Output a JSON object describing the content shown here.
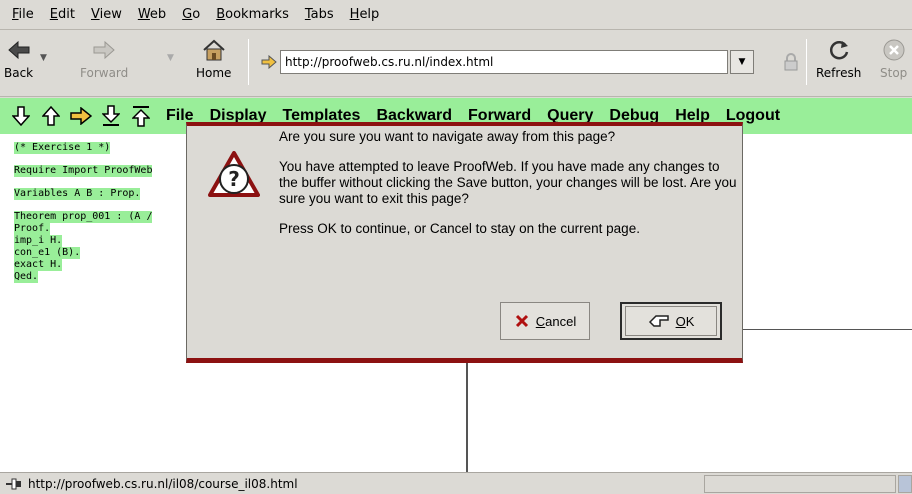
{
  "menu": [
    "File",
    "Edit",
    "View",
    "Web",
    "Go",
    "Bookmarks",
    "Tabs",
    "Help"
  ],
  "nav": {
    "back": "Back",
    "forward": "Forward",
    "home": "Home",
    "url": "http://proofweb.cs.ru.nl/index.html",
    "refresh": "Refresh",
    "stop": "Stop"
  },
  "page_toolbar": {
    "menus": [
      "File",
      "Display",
      "Templates",
      "Backward",
      "Forward",
      "Query",
      "Debug",
      "Help",
      "Logout"
    ]
  },
  "editor": {
    "lines": [
      "(* Exercise 1 *)",
      "",
      "Require Import ProofWeb",
      "",
      "Variables A B : Prop.",
      "",
      "Theorem prop_001 : (A /",
      "Proof.",
      "imp_i H.",
      "con_e1 (B).",
      "exact H.",
      "Qed."
    ]
  },
  "dialog": {
    "title": "Are you sure you want to navigate away from this page?",
    "body": "You have attempted to leave ProofWeb.  If you have made any changes to the buffer without clicking the Save button, your changes will be lost.  Are you sure you want to exit this page?",
    "hint": "Press OK to continue, or Cancel to stay on the current page.",
    "cancel": "Cancel",
    "ok": "OK"
  },
  "status": {
    "text": "http://proofweb.cs.ru.nl/il08/course_il08.html"
  },
  "colors": {
    "page_toolbar_bg": "#99ee99",
    "dialog_border": "#8c1111"
  }
}
